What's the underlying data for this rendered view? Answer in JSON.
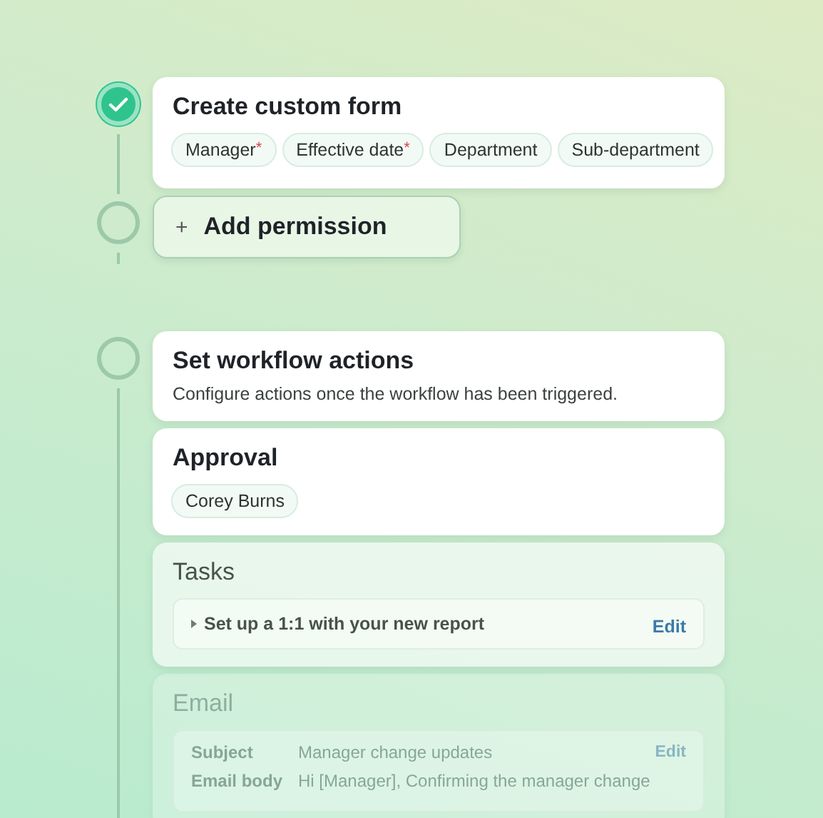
{
  "steps": [
    {
      "done": true,
      "kind": "form",
      "title": "Create custom form",
      "fields": [
        {
          "label": "Manager",
          "required_mark": "*"
        },
        {
          "label": "Effective date",
          "required_mark": "*"
        },
        {
          "label": "Department"
        },
        {
          "label": "Sub-department"
        }
      ]
    },
    {
      "done": false,
      "kind": "add",
      "icon": "+",
      "label": "Add permission"
    },
    {
      "done": false,
      "kind": "actions",
      "cards": [
        {
          "kind": "intro",
          "faded": false,
          "disabled": false,
          "title": "Set workflow actions",
          "description": "Configure actions once the workflow has been triggered."
        },
        {
          "kind": "chips",
          "faded": false,
          "disabled": false,
          "title": "Approval",
          "chips": [
            "Corey Burns"
          ]
        },
        {
          "kind": "tasks",
          "faded": true,
          "disabled": false,
          "title": "Tasks",
          "tasks": [
            {
              "label": "Set up a 1:1 with your new report",
              "action": "Edit"
            }
          ]
        },
        {
          "kind": "email",
          "faded": true,
          "disabled": true,
          "title": "Email",
          "rows": [
            {
              "label": "Subject",
              "value": "Manager change updates",
              "action": "Edit"
            },
            {
              "label": "Email body",
              "value": "Hi [Manager], Confirming the manager change"
            }
          ]
        }
      ]
    }
  ]
}
